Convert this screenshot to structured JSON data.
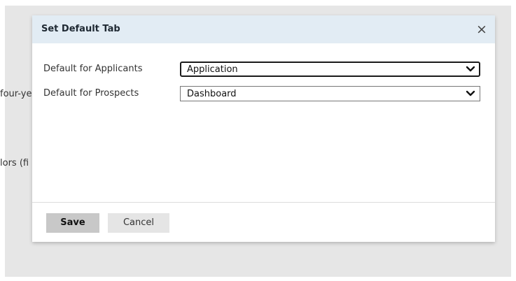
{
  "background": {
    "fragments": [
      "four-ye",
      "lors (fi"
    ]
  },
  "dialog": {
    "title": "Set Default Tab",
    "close_symbol": "×",
    "fields": [
      {
        "label": "Default for Applicants",
        "value": "Application",
        "focused": true
      },
      {
        "label": "Default for Prospects",
        "value": "Dashboard",
        "focused": false
      }
    ],
    "buttons": {
      "save_label": "Save",
      "cancel_label": "Cancel"
    }
  },
  "colors": {
    "header_bg": "#e2ecf4",
    "overlay_bg": "#e6e6e6",
    "save_bg": "#c8c8c8",
    "cancel_bg": "#e5e5e5"
  },
  "icons": {
    "close": "close-icon",
    "dropdown": "chevron-down-icon"
  }
}
